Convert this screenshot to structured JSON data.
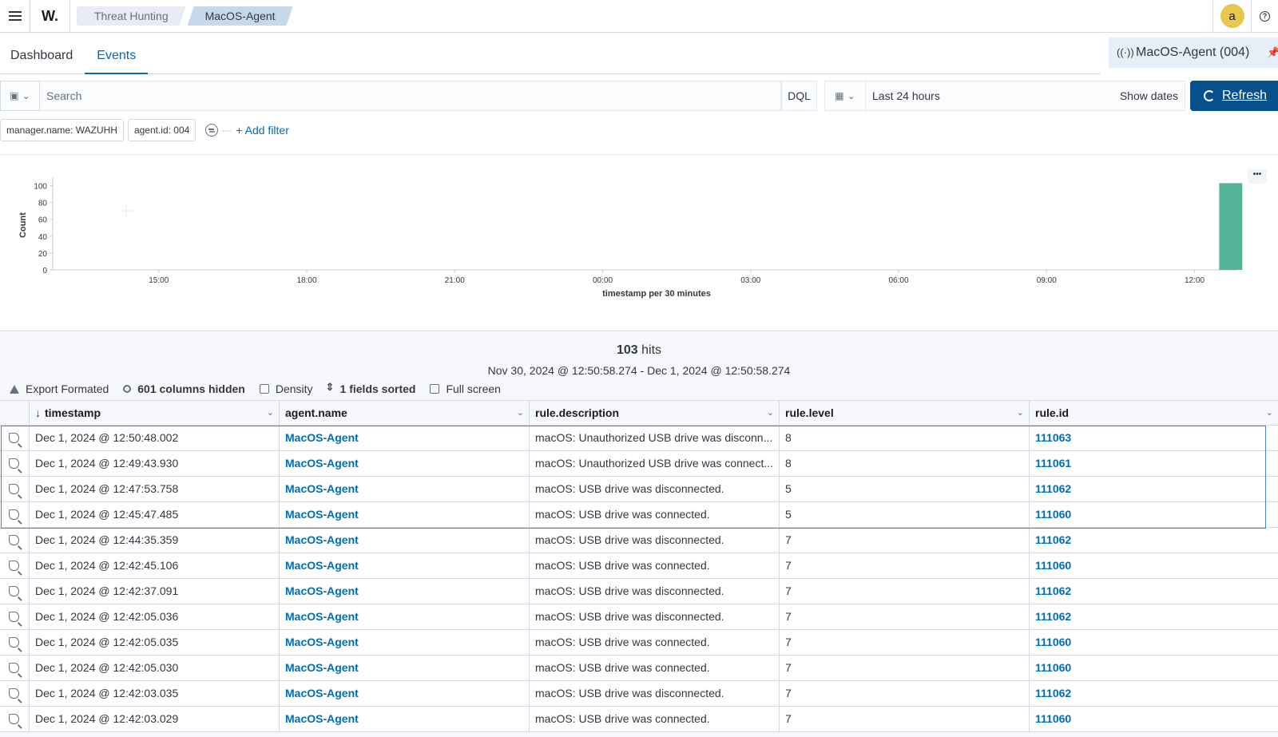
{
  "topbar": {
    "logo": "W.",
    "breadcrumbs": [
      "Threat Hunting",
      "MacOS-Agent"
    ],
    "avatar_letter": "a",
    "help": "?"
  },
  "tabs": [
    {
      "label": "Dashboard",
      "active": false
    },
    {
      "label": "Events",
      "active": true
    }
  ],
  "agent_pill": {
    "label": "MacOS-Agent (004)"
  },
  "query": {
    "placeholder": "Search",
    "language": "DQL",
    "time_range": "Last 24 hours",
    "show_dates": "Show dates",
    "refresh": "Refresh"
  },
  "filters": {
    "pills": [
      "manager.name: WAZUHH",
      "agent.id: 004"
    ],
    "add_filter": "+ Add filter"
  },
  "chart_data": {
    "type": "bar",
    "ylabel": "Count",
    "xlabel": "timestamp per 30 minutes",
    "y_ticks": [
      0,
      20,
      40,
      60,
      80,
      100
    ],
    "ylim": [
      0,
      110
    ],
    "x_tick_labels": [
      "15:00",
      "18:00",
      "21:00",
      "00:00",
      "03:00",
      "06:00",
      "09:00",
      "12:00"
    ],
    "x_tick_hours": [
      15,
      18,
      21,
      24,
      27,
      30,
      33,
      36
    ],
    "x_range_hours": [
      12.85,
      36.85
    ],
    "bars": [
      {
        "start_hour": 36.5,
        "value": 103
      }
    ],
    "bar_color": "#54b399",
    "grid": false
  },
  "hits": {
    "count": "103",
    "label": "hits",
    "range": "Nov 30, 2024 @ 12:50:58.274 - Dec 1, 2024 @ 12:50:58.274"
  },
  "grid_tools": {
    "export": "Export Formated",
    "columns_hidden": "601 columns hidden",
    "density": "Density",
    "sorted": "1 fields sorted",
    "fullscreen": "Full screen"
  },
  "table": {
    "columns": [
      "timestamp",
      "agent.name",
      "rule.description",
      "rule.level",
      "rule.id"
    ],
    "rows": [
      [
        "Dec 1, 2024 @ 12:50:48.002",
        "MacOS-Agent",
        "macOS: Unauthorized USB drive was disconn...",
        "8",
        "111063"
      ],
      [
        "Dec 1, 2024 @ 12:49:43.930",
        "MacOS-Agent",
        "macOS: Unauthorized USB drive was connect...",
        "8",
        "111061"
      ],
      [
        "Dec 1, 2024 @ 12:47:53.758",
        "MacOS-Agent",
        "macOS: USB drive was disconnected.",
        "5",
        "111062"
      ],
      [
        "Dec 1, 2024 @ 12:45:47.485",
        "MacOS-Agent",
        "macOS: USB drive was connected.",
        "5",
        "111060"
      ],
      [
        "Dec 1, 2024 @ 12:44:35.359",
        "MacOS-Agent",
        "macOS: USB drive was disconnected.",
        "7",
        "111062"
      ],
      [
        "Dec 1, 2024 @ 12:42:45.106",
        "MacOS-Agent",
        "macOS: USB drive was connected.",
        "7",
        "111060"
      ],
      [
        "Dec 1, 2024 @ 12:42:37.091",
        "MacOS-Agent",
        "macOS: USB drive was disconnected.",
        "7",
        "111062"
      ],
      [
        "Dec 1, 2024 @ 12:42:05.036",
        "MacOS-Agent",
        "macOS: USB drive was disconnected.",
        "7",
        "111062"
      ],
      [
        "Dec 1, 2024 @ 12:42:05.035",
        "MacOS-Agent",
        "macOS: USB drive was connected.",
        "7",
        "111060"
      ],
      [
        "Dec 1, 2024 @ 12:42:05.030",
        "MacOS-Agent",
        "macOS: USB drive was connected.",
        "7",
        "111060"
      ],
      [
        "Dec 1, 2024 @ 12:42:03.035",
        "MacOS-Agent",
        "macOS: USB drive was disconnected.",
        "7",
        "111062"
      ],
      [
        "Dec 1, 2024 @ 12:42:03.029",
        "MacOS-Agent",
        "macOS: USB drive was connected.",
        "7",
        "111060"
      ]
    ]
  },
  "colors": {
    "accent": "#006bb8",
    "refresh_bg": "#07508e",
    "avatar": "#e7c74d",
    "bar": "#54b399"
  }
}
